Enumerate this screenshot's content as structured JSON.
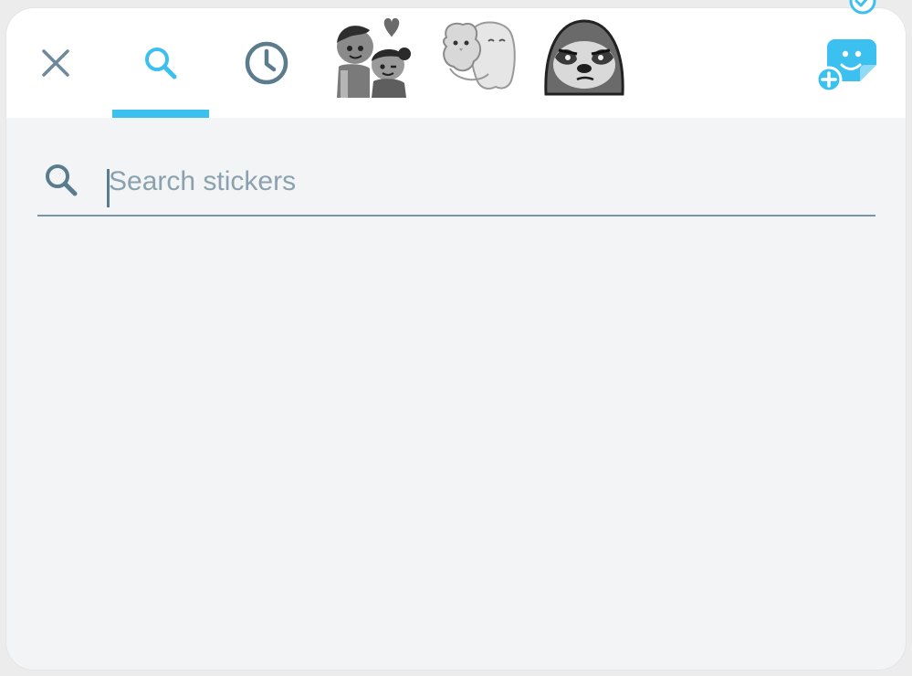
{
  "tabs": [
    {
      "id": "close",
      "icon": "close-icon"
    },
    {
      "id": "search",
      "icon": "search-icon",
      "active": true
    },
    {
      "id": "recent",
      "icon": "clock-icon"
    },
    {
      "id": "pack-couple",
      "icon": "sticker-couple"
    },
    {
      "id": "pack-ghosts",
      "icon": "sticker-ghosts"
    },
    {
      "id": "pack-sloth",
      "icon": "sticker-sloth"
    },
    {
      "id": "add-pack",
      "icon": "add-sticker-icon"
    }
  ],
  "search": {
    "placeholder": "Search stickers",
    "value": ""
  },
  "colors": {
    "accent": "#3cc0f0",
    "icon_gray": "#6e8a98",
    "background": "#f3f4f6",
    "topbar": "#ffffff"
  }
}
